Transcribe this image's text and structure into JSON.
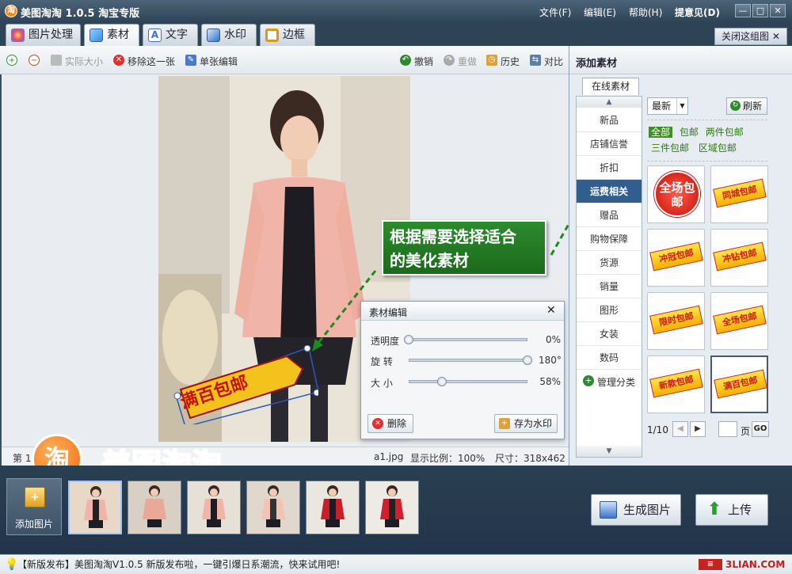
{
  "app": {
    "title": "美图淘淘 1.0.5 淘宝专版",
    "logo_char": "淘"
  },
  "menu": {
    "file": "文件(F)",
    "edit": "编辑(E)",
    "help": "帮助(H)",
    "feedback": "提意见(D)"
  },
  "window_buttons": {
    "restore": "▭",
    "minimize": "—",
    "maximize": "□",
    "close": "✕"
  },
  "tabs": [
    {
      "label": "图片处理",
      "icon": "palette-icon",
      "color": "#e04a7a"
    },
    {
      "label": "素材",
      "icon": "sticker-icon",
      "color": "#3b8de0"
    },
    {
      "label": "文字",
      "icon": "text-icon",
      "color": "#3b6fd0"
    },
    {
      "label": "水印",
      "icon": "watermark-icon",
      "color": "#2f72c6"
    },
    {
      "label": "边框",
      "icon": "frame-icon",
      "color": "#d89a1a"
    }
  ],
  "close_group": "关闭这组图",
  "toolbar": {
    "actual_size": "实际大小",
    "remove_one": "移除这一张",
    "single_edit": "单张编辑",
    "undo": "撤销",
    "redo": "重做",
    "history": "历史",
    "compare": "对比"
  },
  "status": {
    "page_prefix": "第 1",
    "filename": "a1.jpg",
    "zoom": "显示比例：100%",
    "size": "尺寸：318x462"
  },
  "callout": {
    "line1": "根据需要选择适合",
    "line2": "的美化素材"
  },
  "sticker_on_photo": "满百包邮",
  "edit_panel": {
    "title": "素材编辑",
    "close": "✕",
    "opacity_label": "透明度",
    "opacity_value": "0%",
    "opacity_level": 0,
    "rotate_label": "旋 转",
    "rotate_value": "180°",
    "rotate_level": 1,
    "size_label": "大 小",
    "size_value": "58%",
    "size_level": 0.28,
    "delete": "删除",
    "save_watermark": "存为水印"
  },
  "right_panel": {
    "title": "添加素材",
    "online_tab": "在线素材",
    "categories": [
      "新品",
      "店铺信誉",
      "折扣",
      "运费相关",
      "赠品",
      "购物保障",
      "货源",
      "销量",
      "图形",
      "女装",
      "数码"
    ],
    "active_category": "运费相关",
    "manage": "管理分类",
    "sort": "最新",
    "refresh": "刷新",
    "tags": [
      "全部",
      "包邮",
      "两件包邮",
      "三件包邮",
      "区域包邮"
    ],
    "materials": [
      "全场包邮",
      "同城包邮",
      "冲冠包邮",
      "冲钻包邮",
      "限时包邮",
      "全场包邮",
      "新款包邮",
      "满百包邮"
    ],
    "pager": "1/10",
    "page_suffix": "页",
    "go": "GO"
  },
  "bottom": {
    "add_image": "添加图片",
    "generate": "生成图片",
    "upload": "上传",
    "brand": "美图淘淘"
  },
  "ticker": "【新版发布】美图淘淘V1.0.5 新版发布啦，一键引爆日系潮流，快来试用吧!",
  "watermark_site": "3LIAN.COM"
}
